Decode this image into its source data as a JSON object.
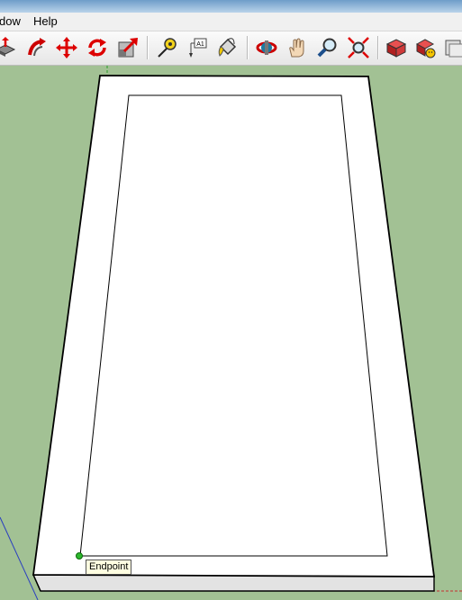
{
  "menu": {
    "items": [
      "dow",
      "Help"
    ]
  },
  "toolbar": {
    "tools": [
      {
        "icon": "push-pull-icon"
      },
      {
        "icon": "follow-me-icon"
      },
      {
        "icon": "move-icon"
      },
      {
        "icon": "rotate-icon"
      },
      {
        "icon": "scale-icon"
      },
      {
        "icon": "tape-measure-icon"
      },
      {
        "icon": "text-icon"
      },
      {
        "icon": "paint-bucket-icon"
      },
      {
        "icon": "orbit-icon"
      },
      {
        "icon": "pan-icon"
      },
      {
        "icon": "zoom-icon"
      },
      {
        "icon": "zoom-extents-icon"
      },
      {
        "icon": "camera-views-icon"
      },
      {
        "icon": "materials-icon"
      },
      {
        "icon": "components-icon"
      }
    ],
    "text_tool_label": "A1"
  },
  "viewport": {
    "background_color": "#a2c194",
    "inference_tooltip": "Endpoint",
    "inference_point_color": "#2db82d"
  }
}
